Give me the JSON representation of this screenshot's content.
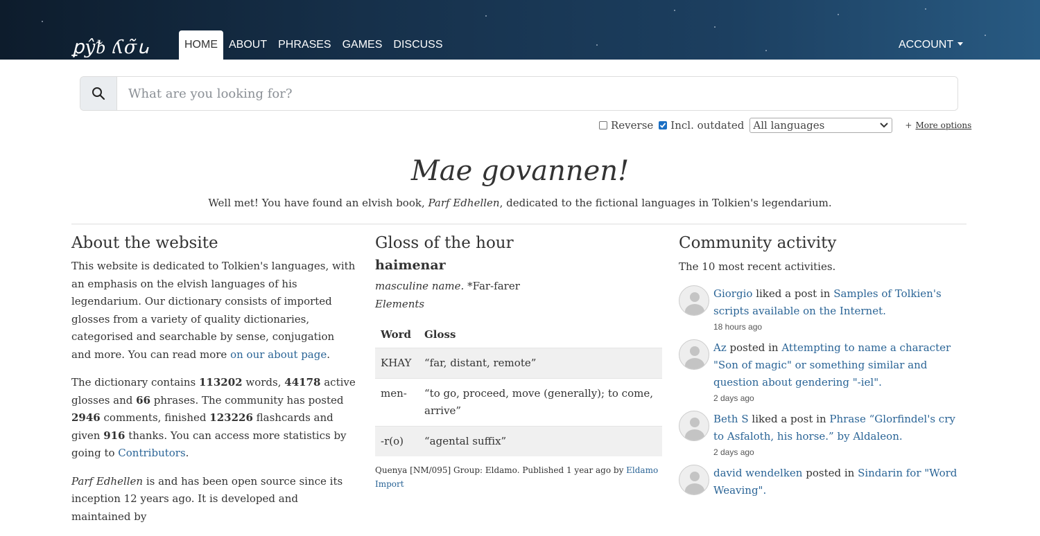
{
  "nav": {
    "brand": "ꝑŷᵬ ʎσ̃ꭎ",
    "items": [
      "HOME",
      "ABOUT",
      "PHRASES",
      "GAMES",
      "DISCUSS"
    ],
    "account": "ACCOUNT"
  },
  "search": {
    "placeholder": "What are you looking for?",
    "reverse_label": "Reverse",
    "outdated_label": "Incl. outdated",
    "language_selected": "All languages",
    "more_options": "More options"
  },
  "hero": {
    "title": "Mae govannen!",
    "sub_before": "Well met! You have found an elvish book, ",
    "sub_em": "Parf Edhellen",
    "sub_after": ", dedicated to the fictional languages in Tolkien's legendarium."
  },
  "about": {
    "title": "About the website",
    "p1": "This website is dedicated to Tolkien's languages, with an emphasis on the elvish languages of his legendarium. Our dictionary consists of imported glosses from a variety of quality dictionaries, categorised and searchable by sense, conjugation and more. You can read more ",
    "p1_link": "on our about page",
    "p1_end": ".",
    "p2_a": "The dictionary contains ",
    "words": "113202",
    "p2_b": " words, ",
    "glosses": "44178",
    "p2_c": " active glosses and ",
    "phrases": "66",
    "p2_d": " phrases. The community has posted ",
    "comments": "2946",
    "p2_e": " comments, finished ",
    "flashcards": "123226",
    "p2_f": " flashcards and given ",
    "thanks": "916",
    "p2_g": " thanks. You can access more statistics by going to ",
    "p2_link": "Contributors",
    "p2_end": ".",
    "p3_em": "Parf Edhellen",
    "p3_rest": " is and has been open source since its inception 12 years ago. It is developed and maintained by"
  },
  "gloss": {
    "title": "Gloss of the hour",
    "word": "haimenar",
    "type": "masculine name.",
    "meaning": " *Far-farer",
    "elements_label": "Elements",
    "col_word": "Word",
    "col_gloss": "Gloss",
    "rows": [
      {
        "word": "KHAY",
        "gloss": "“far, distant, remote”"
      },
      {
        "word": "men-",
        "gloss": "“to go, proceed, move (generally); to come, arrive”"
      },
      {
        "word": "-r(o)",
        "gloss": "“agental suffix”"
      }
    ],
    "footer": "Quenya [NM/095] Group: Eldamo. Published 1 year ago by ",
    "footer_link": "Eldamo Import"
  },
  "community": {
    "title": "Community activity",
    "subtitle": "The 10 most recent activities.",
    "activities": [
      {
        "user": "Giorgio",
        "action": " liked a post in ",
        "target": "Samples of Tolkien's scripts available on the Internet.",
        "time": "18 hours ago"
      },
      {
        "user": "Az",
        "action": " posted in ",
        "target": "Attempting to name a character \"Son of magic\" or something similar and question about gendering \"-iel\".",
        "time": "2 days ago"
      },
      {
        "user": "Beth S",
        "action": " liked a post in ",
        "target": "Phrase “Glorfindel's cry to Asfaloth, his horse.” by Aldaleon.",
        "time": "2 days ago"
      },
      {
        "user": "david wendelken",
        "action": " posted in ",
        "target": "Sindarin for \"Word Weaving\".",
        "time": ""
      }
    ]
  }
}
